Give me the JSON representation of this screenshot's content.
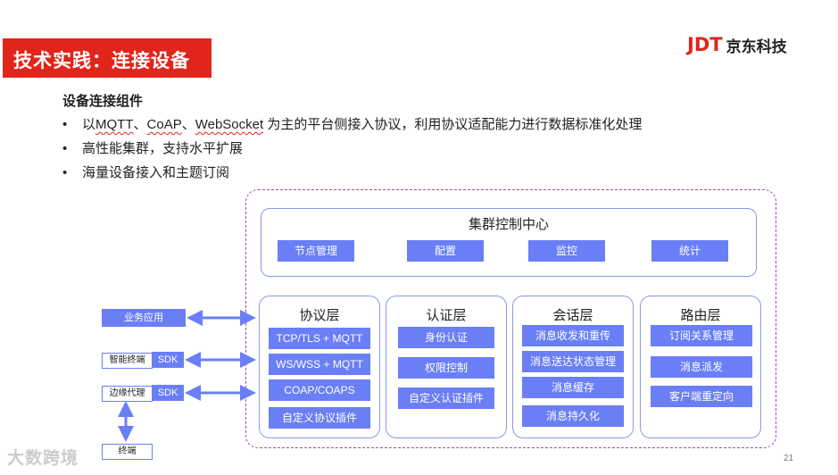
{
  "slide": {
    "title": "技术实践：连接设备",
    "logo_mark": "JDT",
    "logo_text": "京东科技",
    "subheading": "设备连接组件",
    "bullets": [
      {
        "parts": [
          "以",
          "MQTT",
          "、",
          "CoAP",
          "、",
          "WebSocket",
          " 为主的平台侧接入协议，利用协议适配能力进行数据标准化处理"
        ]
      },
      {
        "text": "高性能集群，支持水平扩展"
      },
      {
        "text": "海量设备接入和主题订阅"
      }
    ],
    "bullet_symbol": "•",
    "page_number": "21",
    "watermark": "大数跨境"
  },
  "diagram": {
    "cluster": {
      "title": "集群控制中心",
      "items": [
        "节点管理",
        "配置",
        "监控",
        "统计"
      ]
    },
    "layers": [
      {
        "title": "协议层",
        "items": [
          "TCP/TLS + MQTT",
          "WS/WSS + MQTT",
          "COAP/COAPS",
          "自定义协议插件"
        ]
      },
      {
        "title": "认证层",
        "items": [
          "身份认证",
          "权限控制",
          "自定义认证插件"
        ]
      },
      {
        "title": "会话层",
        "items": [
          "消息收发和重传",
          "消息送达状态管理",
          "消息缓存",
          "消息持久化"
        ]
      },
      {
        "title": "路由层",
        "items": [
          "订阅关系管理",
          "消息派发",
          "客户端重定向"
        ]
      }
    ],
    "clients": {
      "business_app": "业务应用",
      "smart_terminal": "智能终端",
      "edge_proxy": "边缘代理",
      "sdk": "SDK",
      "terminal": "终端"
    }
  },
  "colors": {
    "accent_red": "#e1251b",
    "block_blue": "#6a7ff5",
    "border_blue": "#8b9be0",
    "outer_dash": "#a24ab0"
  }
}
